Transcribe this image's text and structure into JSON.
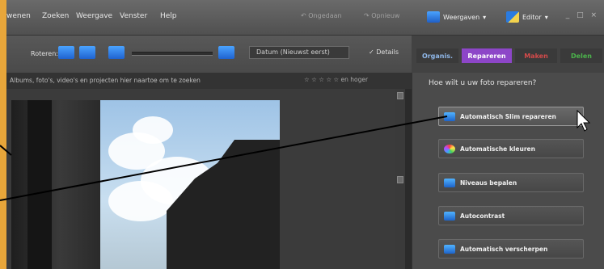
{
  "menu": {
    "items": [
      "wenen",
      "Zoeken",
      "Weergave",
      "Venster",
      "Help"
    ],
    "organize": "Ongedaan",
    "redo": "Opnieuw",
    "view_button": "Weergaven",
    "editor_button": "Editor",
    "window_controls": "_ □ ×"
  },
  "toolbar": {
    "sort_label": "Roteren:",
    "date_select": "Datum (Nieuwst eerst)",
    "details_label": "Details"
  },
  "tabs": [
    "Organis.",
    "Repareren",
    "Maken",
    "Delen"
  ],
  "hint": {
    "text": "Albums, foto's, video's en projecten hier naartoe om te zoeken",
    "rating": "☆ ☆ ☆ ☆ ☆ en hoger"
  },
  "panel": {
    "title": "Hoe wilt u uw foto repareren?",
    "buttons": [
      "Automatisch Slim repareren",
      "Automatische kleuren",
      "Niveaus bepalen",
      "Autocontrast",
      "Automatisch verscherpen"
    ]
  },
  "colors": {
    "accent_purple": "#8d46c8",
    "strip_orange": "#e8a63a"
  }
}
